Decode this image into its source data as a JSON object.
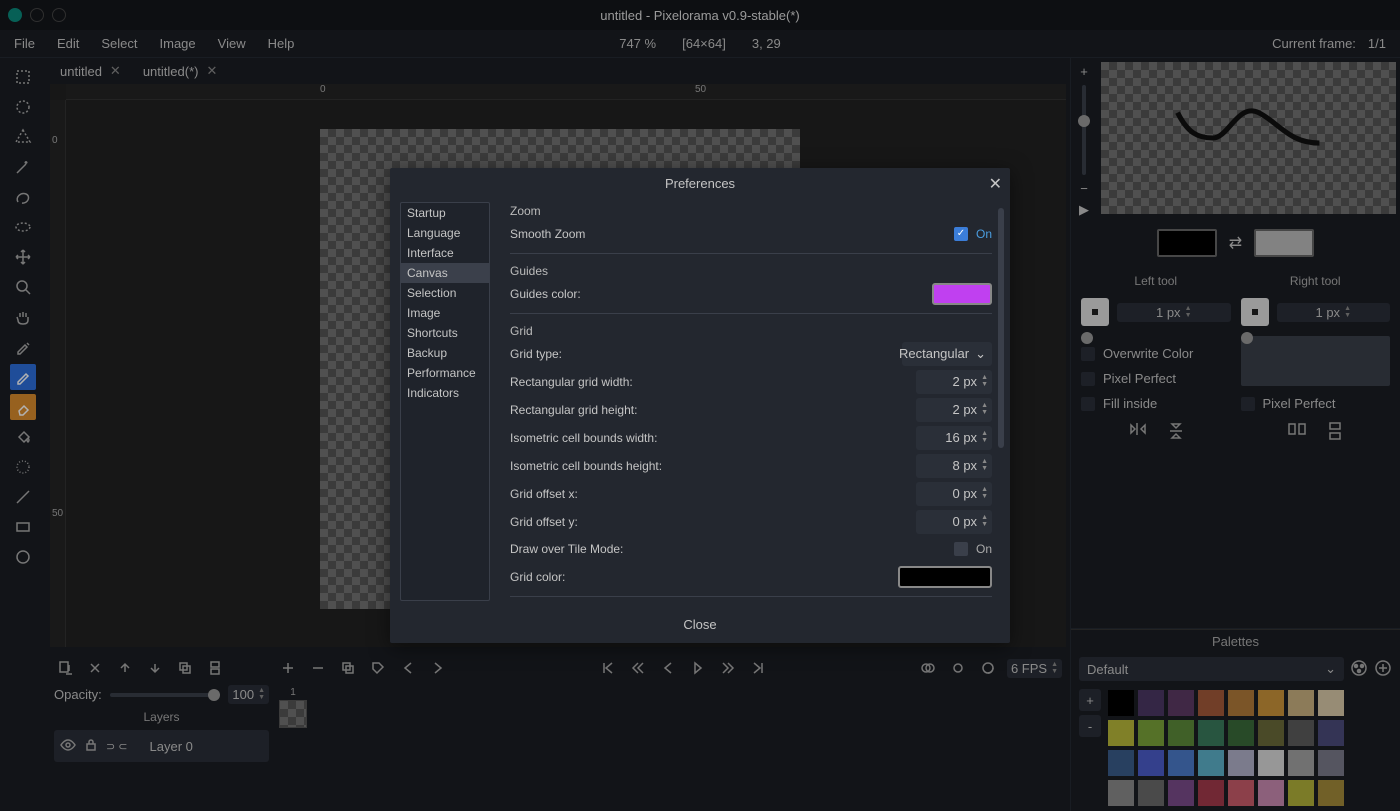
{
  "title": "untitled - Pixelorama v0.9-stable(*)",
  "menu": [
    "File",
    "Edit",
    "Select",
    "Image",
    "View",
    "Help"
  ],
  "info": {
    "zoom": "747 %",
    "dims": "[64×64]",
    "pos": "3, 29",
    "curframe_lbl": "Current frame:",
    "curframe": "1/1"
  },
  "tabs": [
    {
      "label": "untitled"
    },
    {
      "label": "untitled(*)"
    }
  ],
  "ruler": {
    "h0": "0",
    "h50": "50",
    "v0": "0",
    "v50": "50"
  },
  "layers": {
    "opacity_lbl": "Opacity:",
    "opacity_val": "100",
    "header": "Layers",
    "row_label": "Layer 0",
    "frame1": "1"
  },
  "timeline": {
    "fps": "6 FPS"
  },
  "right": {
    "left_tool": "Left tool",
    "right_tool": "Right tool",
    "left_px": "1 px",
    "right_px": "1 px",
    "overwrite": "Overwrite Color",
    "pixelp": "Pixel Perfect",
    "fill": "Fill inside"
  },
  "palettes": {
    "header": "Palettes",
    "selected": "Default",
    "plus": "+",
    "minus": "-",
    "colors": [
      "#000000",
      "#4b3763",
      "#5c3a63",
      "#a35a3a",
      "#b07a3a",
      "#c9923a",
      "#c9b080",
      "#d9c9a8",
      "#b8b83a",
      "#7aa33a",
      "#5c8a3a",
      "#3a7a5c",
      "#3a6b3a",
      "#6b6b3a",
      "#5c5c5c",
      "#4b4b7a",
      "#3a5c8a",
      "#4b5cc9",
      "#4b7ac9",
      "#5cb0c9",
      "#b0b0c9",
      "#d9d9d9",
      "#a3a3a3",
      "#7a7a8a",
      "#8a8a8a",
      "#6b6b6b",
      "#7a4b8a",
      "#a33a4b",
      "#c95c6b",
      "#c98ab0",
      "#b0b03a",
      "#a38a3a"
    ]
  },
  "prefs": {
    "title": "Preferences",
    "categories": [
      "Startup",
      "Language",
      "Interface",
      "Canvas",
      "Selection",
      "Image",
      "Shortcuts",
      "Backup",
      "Performance",
      "Indicators"
    ],
    "sel_index": 3,
    "zoom_hdr": "Zoom",
    "smooth_lbl": "Smooth Zoom",
    "smooth_on": "On",
    "guides_hdr": "Guides",
    "guides_color_lbl": "Guides color:",
    "guides_color": "#c040f0",
    "grid_hdr": "Grid",
    "grid_type_lbl": "Grid type:",
    "grid_type": "Rectangular",
    "rgw_lbl": "Rectangular grid width:",
    "rgw": "2 px",
    "rgh_lbl": "Rectangular grid height:",
    "rgh": "2 px",
    "icbw_lbl": "Isometric cell bounds width:",
    "icbw": "16 px",
    "icbh_lbl": "Isometric cell bounds height:",
    "icbh": "8 px",
    "gox_lbl": "Grid offset x:",
    "gox": "0 px",
    "goy_lbl": "Grid offset y:",
    "goy": "0 px",
    "dotm_lbl": "Draw over Tile Mode:",
    "dotm_on": "On",
    "gcol_lbl": "Grid color:",
    "gcol": "#000000",
    "close": "Close"
  }
}
